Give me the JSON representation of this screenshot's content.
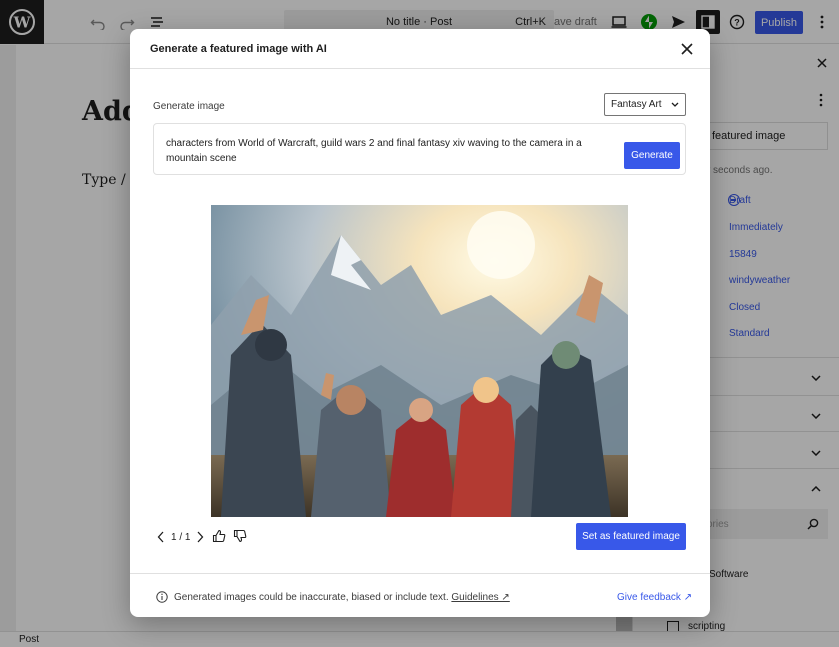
{
  "toolbar": {
    "post_title": "No title · Post",
    "shortcut": "Ctrl+K",
    "save_draft": "ave draft",
    "publish_label": "Publish"
  },
  "editor": {
    "title_placeholder": "Add",
    "body_placeholder": "Type / t"
  },
  "sidebar": {
    "featured_image_label": "featured image",
    "last_edited": "w seconds ago.",
    "status": "Draft",
    "publish_when": "Immediately",
    "post_id": "15849",
    "author": "windyweather",
    "comments": "Closed",
    "format": "Standard",
    "category_search_placeholder": "ories",
    "category_software": "Software",
    "category_scripting": "scripting"
  },
  "footer": {
    "breadcrumb": "Post"
  },
  "modal": {
    "title": "Generate a featured image with AI",
    "generate_label": "Generate image",
    "style_value": "Fantasy Art",
    "prompt": "characters from World of Warcraft, guild wars 2 and final fantasy xiv waving to the camera in a mountain scene",
    "generate_button": "Generate",
    "pager": "1 / 1",
    "set_featured_button": "Set as featured image",
    "disclaimer": "Generated images could be inaccurate, biased or include text.",
    "guidelines_link": "Guidelines ↗",
    "feedback_link": "Give feedback ↗"
  },
  "colors": {
    "accent": "#3858e9",
    "dark": "#1e1e1e"
  }
}
